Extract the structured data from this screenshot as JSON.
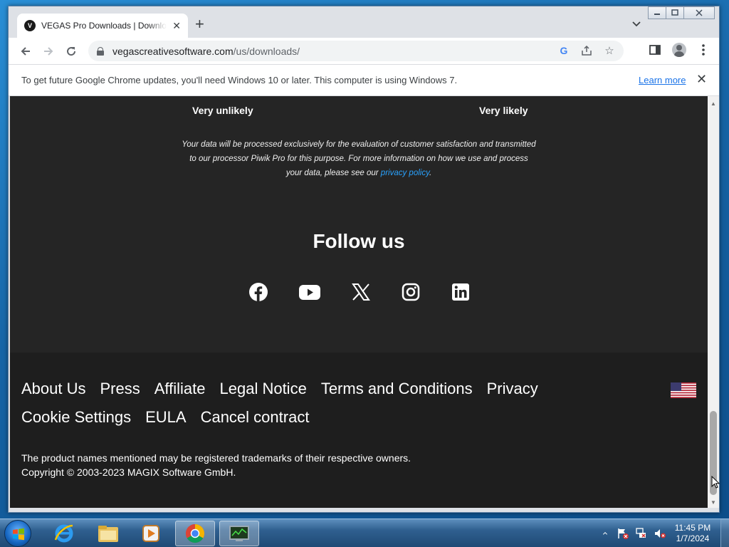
{
  "browser": {
    "tab_title": "VEGAS Pro Downloads | Download",
    "tab_favicon_letter": "V",
    "url_domain": "vegascreativesoftware.com",
    "url_path": "/us/downloads/"
  },
  "infobar": {
    "message": "To get future Google Chrome updates, you'll need Windows 10 or later. This computer is using Windows 7.",
    "learn_more": "Learn more"
  },
  "survey": {
    "low_label": "Very unlikely",
    "high_label": "Very likely",
    "privacy_text": "Your data will be processed exclusively for the evaluation of customer satisfaction and transmitted to our processor Piwik Pro for this purpose. For more information on how we use and process your data, please see our",
    "privacy_link": "privacy policy",
    "privacy_end": "."
  },
  "follow": {
    "title": "Follow us",
    "networks": [
      "facebook-icon",
      "youtube-icon",
      "x-icon",
      "instagram-icon",
      "linkedin-icon"
    ]
  },
  "footer": {
    "links": [
      "About Us",
      "Press",
      "Affiliate",
      "Legal Notice",
      "Terms and Conditions",
      "Privacy",
      "Cookie Settings",
      "EULA",
      "Cancel contract"
    ],
    "trademark": "The product names mentioned may be registered trademarks of their respective owners.",
    "copyright": "Copyright © 2003-2023 MAGIX Software GmbH."
  },
  "taskbar": {
    "time": "11:45 PM",
    "date": "1/7/2024"
  },
  "colors": {
    "page_bg": "#252525",
    "footer_bg": "#1e1e1e",
    "link_accent": "#29a3ff",
    "chrome_blue": "#1a73e8"
  }
}
